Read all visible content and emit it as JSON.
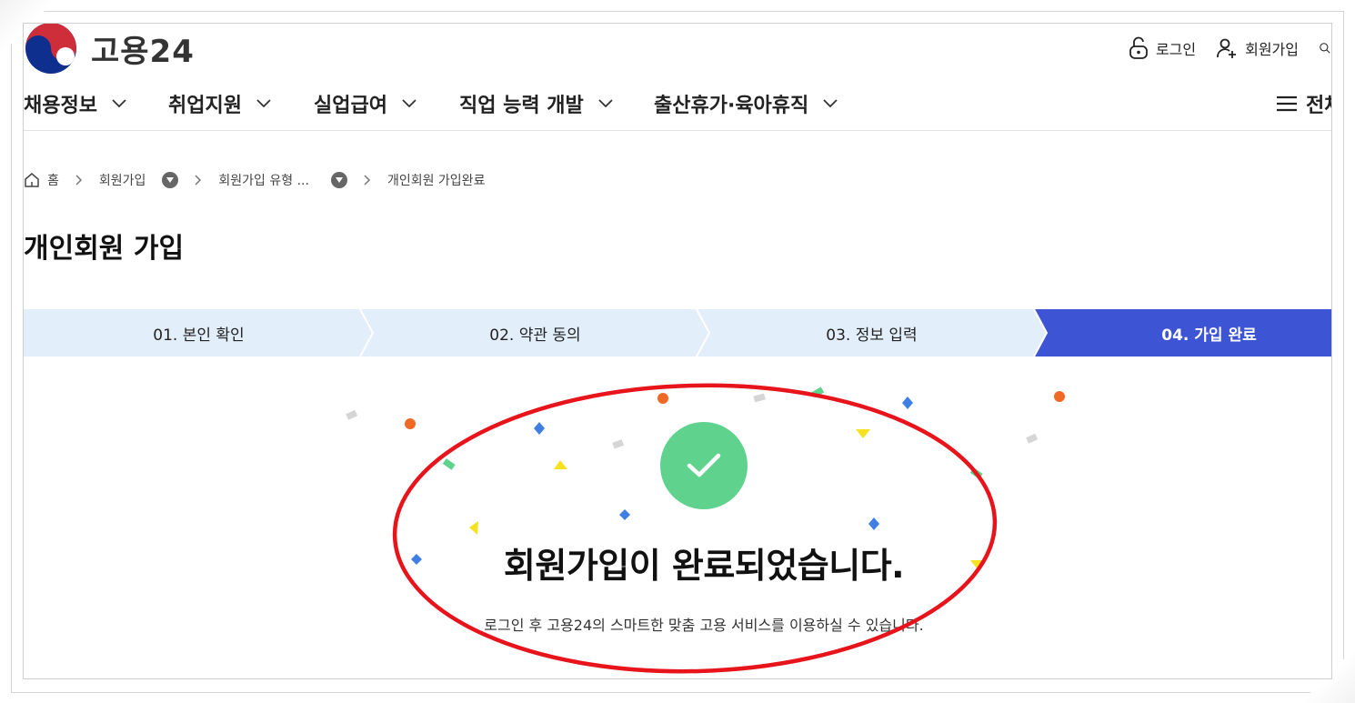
{
  "header": {
    "logo_text": "고용24",
    "util": {
      "login": "로그인",
      "signup": "회원가입"
    }
  },
  "gnb": {
    "items": [
      {
        "label": "채용정보"
      },
      {
        "label": "취업지원"
      },
      {
        "label": "실업급여"
      },
      {
        "label": "직업 능력 개발"
      },
      {
        "label": "출산휴가·육아휴직"
      }
    ],
    "all_menu": "전체"
  },
  "breadcrumb": {
    "home": "홈",
    "level1": "회원가입",
    "level2": "회원가입 유형 ...",
    "current": "개인회원 가입완료"
  },
  "page_title": "개인회원 가입",
  "steps": [
    {
      "label": "01. 본인 확인",
      "active": false
    },
    {
      "label": "02. 약관 동의",
      "active": false
    },
    {
      "label": "03. 정보 입력",
      "active": false
    },
    {
      "label": "04. 가입 완료",
      "active": true
    }
  ],
  "completion": {
    "title": "회원가입이 완료되었습니다.",
    "description": "로그인 후 고용24의 스마트한 맞춤 고용 서비스를 이용하실 수 있습니다."
  },
  "colors": {
    "step_inactive_bg": "#e3eefb",
    "step_active_bg": "#3d55d4",
    "check_green": "#5fd38d",
    "highlight_red": "#e8141b",
    "logo_red": "#cd2e3a",
    "logo_blue": "#0f2f8f"
  }
}
